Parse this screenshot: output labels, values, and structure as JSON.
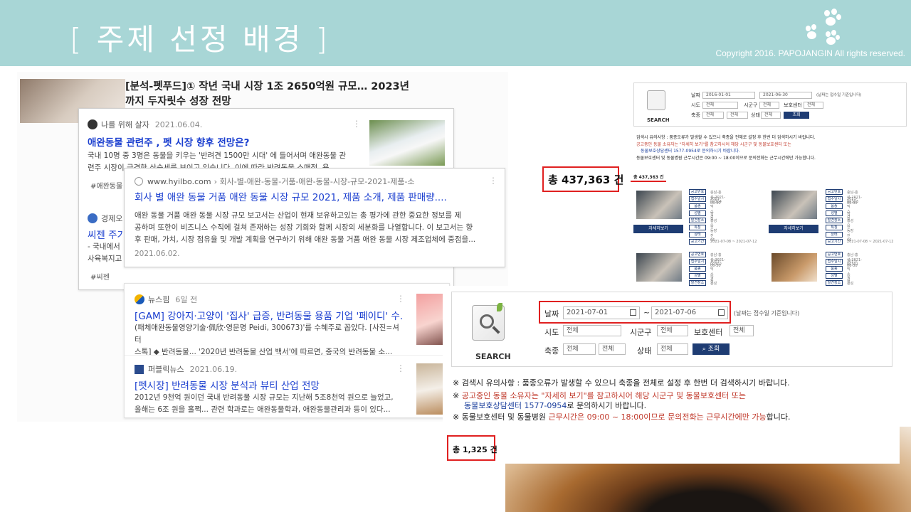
{
  "header": {
    "title": "[  주제 선정 배경  ]",
    "copyright": "Copyright 2016. PAPOJANGIN All rights reserved."
  },
  "article": {
    "headline": "[분석-펫푸드]① 작년 국내 시장 1조 2650억원 규모… 2023년까지 두자릿수 성장 전망"
  },
  "results": [
    {
      "source": "나를 위해 살자",
      "date": "2021.06.04.",
      "title": "애완동물 관련주 , 펫 시장 향후 전망은?",
      "snippet1": "국내 10명 중 3명은 동물을 키우는 '반려견 1500만 시대' 에 들어서며 애완동물 관",
      "snippet2": "련주 시장이 급격한 상승세를 보이고 있습니다. 이에 따라 반려동물 소매점, 용",
      "tag": "#애완동물"
    },
    {
      "source": "www.hyilbo.com",
      "path": "› 회사-별-애완-동물-거품-애완-동물-시장-규모-2021-제품-소",
      "title": "회사 별 애완 동물 거품 애완 동물 시장 규모 2021, 제품 소개, 제품 판매량....",
      "snippet1": "애완 동물 거품 애완 동물 시장 규모 보고서는 산업이 현재 보유하고있는 총 평가에 관한 중요한 정보를 제",
      "snippet2": "공하며 또한이 비즈니스 수직에 걸쳐 존재하는 성장 기회와 함께 시장의 세분화를 나열합니다. 이 보고서는 향",
      "snippet3": "후 판매, 가치, 시장 점유율 및 개발 계획을 연구하기 위해 애완 동물 거품 애완 동물 시장 제조업체에 중점을...",
      "date": "2021.06.02."
    },
    {
      "source": "경제오",
      "title": "씨젠 주기",
      "snippet1": "- 국내에서",
      "snippet2": "사육복지고",
      "tag": "#씨젠"
    },
    {
      "source": "뉴스핌",
      "date": "6일 전",
      "title": "[GAM] 강아지·고양이 '집사' 급증, 반려동물 용품 기업 '페이디' 수...",
      "snippet1": "(패체애완동물영양기술·佩欣·영문명 Peidi, 300673)'를 수혜주로 꼽았다. [사진=셔터",
      "snippet2": "스톡] ◆ 반려동물... '2020년 반려동물 산업 백서'에 따르면, 중국의 반려동물 소..."
    },
    {
      "source": "퍼블릭뉴스",
      "date": "2021.06.19.",
      "title": "[펫시장] 반려동물 시장 분석과 뷰티 산업 전망",
      "snippet1": "2012년 9천억 원이던 국내 반려동물 시장 규모는 지난해 5조8천억 원으로 늘었고,",
      "snippet2": "올해는 6조 원을 훌쩍... 관련 학과로는 애완동물학과, 애완동물관리과 등이 있다..."
    }
  ],
  "shot1": {
    "search_label": "SEARCH",
    "date_label": "날짜",
    "date_from": "2016-01-01",
    "date_to": "2021-06-30",
    "date_hint": "(날짜는 접수일 기준입니다)",
    "city_label": "시도",
    "district_label": "시군구",
    "shelter_label": "보호센터",
    "species_label": "축종",
    "state_label": "상태",
    "all": "전체",
    "search_btn": "조회",
    "note1": "검색시 유의사항 : 품종오류가 발생할 수 있으니 축종을 전체로 설정 후 한번 더 검색하시기 바랍니다.",
    "note2": "공고중인 동물 소유자는 \"자세히 보기\"를 참고하시어 해당 시군구 및 동물보호센터 또는",
    "note2b": "동물보호상담센터 1577-0954로 문의하시기 바랍니다.",
    "note3": "동물보호센터 및 동물병원 근무시간은 09:00 ~ 18:00이므로 문의전화는 근무시간에만 가능합니다.",
    "total_small": "총 437,363 건",
    "total_big": "총 437,363 건",
    "detail_btn": "자세히보기",
    "list_items": [
      {
        "id": "충남-홍성-2021-00304",
        "date": "2021-06-30",
        "kind": "믹스견",
        "sex": "암컷",
        "place": "홍성읍 동장진 66.."
      },
      {
        "id": "충남-홍성-2021-00303",
        "date": "2021-06-30",
        "kind": "믹스견",
        "sex": "암컷",
        "place": "홍성읍 동장진 66.."
      },
      {
        "id": "충남-홍성-2021-00302",
        "date": "2021-06-30",
        "kind": "믹스견",
        "sex": "수컷",
        "place": "홍성읍 동장진 66.."
      },
      {
        "id": "충남-홍성-2021-00301",
        "date": "2021-06-30",
        "kind": "믹스견",
        "sex": "수컷",
        "place": "홍성읍 동장진 66.."
      }
    ],
    "range_a": "2021-07-08 ~ 2021-07-12",
    "range_b": "2021-07-08 ~ 2021-07-12",
    "tag_labels": [
      "공고번호",
      "접수일시",
      "품종",
      "성별",
      "발견장소",
      "특징",
      "상태",
      "공고기간"
    ]
  },
  "shot2": {
    "search_label": "SEARCH",
    "date_label": "날짜",
    "date_from": "2021-07-01",
    "date_to": "2021-07-06",
    "date_hint": "(날짜는 접수일 기준입니다)",
    "city_label": "시도",
    "district_label": "시군구",
    "shelter_label": "보호센터",
    "species_label": "축종",
    "state_label": "상태",
    "all": "전체",
    "search_btn": "조회",
    "note1": "검색시 유의사항 : 품종오류가 발생할 수 있으니 축종을 전체로 설정 후 한번 더 검색하시기 바랍니다.",
    "note2a": "공고중인 동물 소유자는 ",
    "note2b": "\"자세히 보기\"",
    "note2c": "를 참고하시어 해당 시군구 및 ",
    "note2d": "동물보호센터",
    "note2e": " 또는",
    "note2f": "동물보호상담센터 1577-0954",
    "note2g": "로 문의하시기 바랍니다.",
    "note3a": "동물보호센터 및 동물병원 ",
    "note3b": "근무시간은 09:00 ~ 18:00이므로 문의전화는 근무시간에만 가능",
    "note3c": "합니다.",
    "total": "총 1,325 건"
  }
}
